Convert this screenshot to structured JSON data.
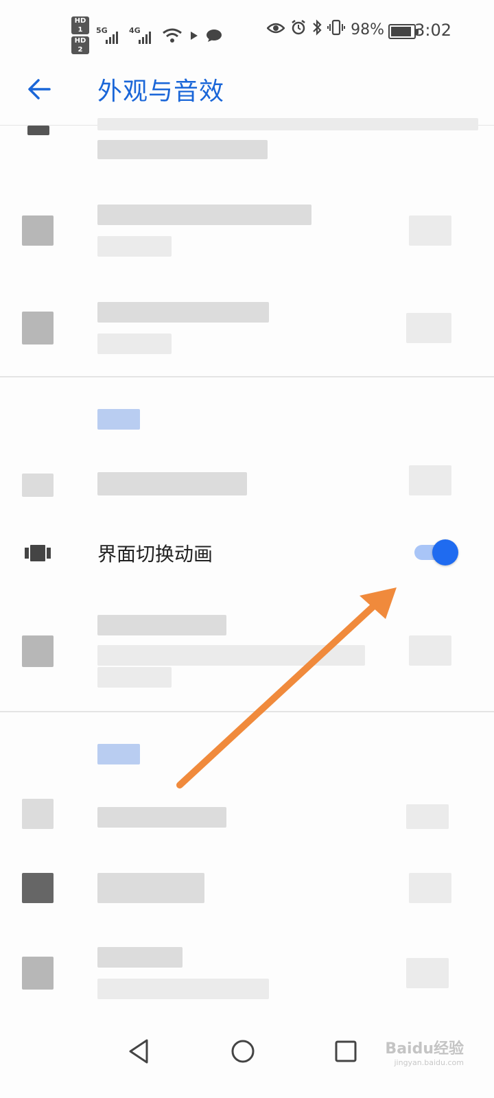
{
  "status_bar": {
    "sim1": "HD 1",
    "sim2": "HD 2",
    "net1": "5G",
    "net2": "4G",
    "battery_percent": "98%",
    "battery_level": 0.98,
    "time": "3:02"
  },
  "header": {
    "title": "外观与音效",
    "back_icon": "arrow-left-icon"
  },
  "settings": {
    "transition_animation": {
      "label": "界面切换动画",
      "enabled": true,
      "icon": "transition-animation-icon"
    }
  },
  "annotation": {
    "arrow_color": "#f08a3c"
  },
  "watermark": {
    "brand": "Baidu经验",
    "url": "jingyan.baidu.com"
  },
  "colors": {
    "accent": "#1a66d8",
    "toggle_on_track": "#a9c5f7",
    "toggle_on_knob": "#1f6bf0"
  }
}
